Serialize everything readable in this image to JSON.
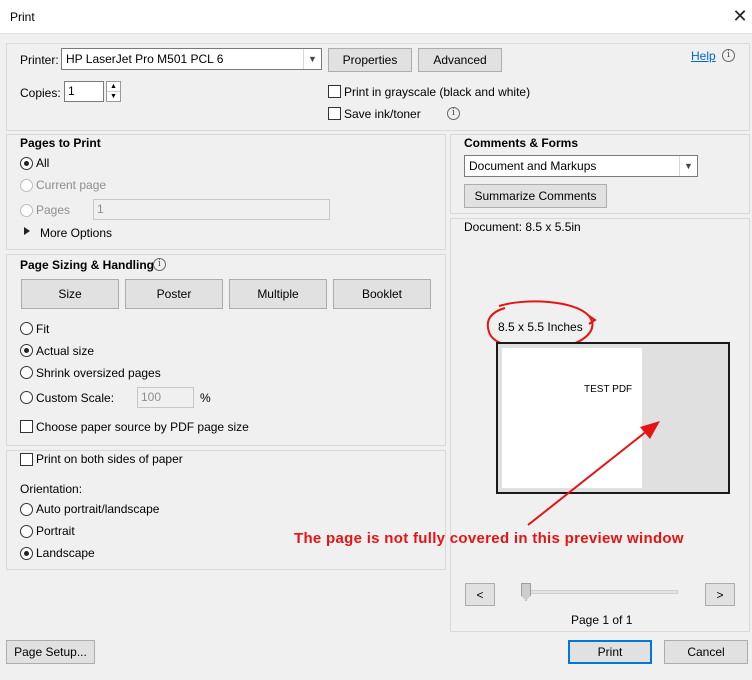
{
  "window": {
    "title": "Print",
    "close_glyph": "✕"
  },
  "printer": {
    "label": "Printer:",
    "selected": "HP LaserJet Pro M501 PCL 6",
    "properties_label": "Properties",
    "advanced_label": "Advanced",
    "help_label": "Help",
    "copies_label": "Copies:",
    "copies_value": "1",
    "grayscale_label": "Print in grayscale (black and white)",
    "save_ink_label": "Save ink/toner"
  },
  "pages_to_print": {
    "heading": "Pages to Print",
    "all_label": "All",
    "current_page_label": "Current page",
    "pages_label": "Pages",
    "pages_value": "1",
    "more_options_label": "More Options"
  },
  "page_sizing": {
    "heading": "Page Sizing & Handling",
    "tabs": [
      "Size",
      "Poster",
      "Multiple",
      "Booklet"
    ],
    "fit_label": "Fit",
    "actual_size_label": "Actual size",
    "shrink_label": "Shrink oversized pages",
    "custom_scale_label": "Custom Scale:",
    "custom_scale_value": "100",
    "percent_label": "%",
    "paper_source_label": "Choose paper source by PDF page size"
  },
  "duplex": {
    "both_sides_label": "Print on both sides of paper",
    "orientation_label": "Orientation:",
    "auto_label": "Auto portrait/landscape",
    "portrait_label": "Portrait",
    "landscape_label": "Landscape"
  },
  "comments_forms": {
    "heading": "Comments & Forms",
    "selected": "Document and Markups",
    "summarize_label": "Summarize Comments"
  },
  "preview": {
    "document_label": "Document: 8.5 x 5.5in",
    "size_annotation": "8.5 x 5.5 Inches",
    "page_text": "TEST PDF",
    "annotation_text": "The page is not fully covered in this preview window",
    "prev_label": "<",
    "next_label": ">",
    "page_indicator": "Page 1 of 1",
    "annotation_color": "#e51414"
  },
  "footer": {
    "page_setup_label": "Page Setup...",
    "print_label": "Print",
    "cancel_label": "Cancel"
  },
  "icons": {
    "info": "info-icon",
    "dropdown": "chevron-down-icon",
    "more_options": "triangle-right-icon"
  }
}
